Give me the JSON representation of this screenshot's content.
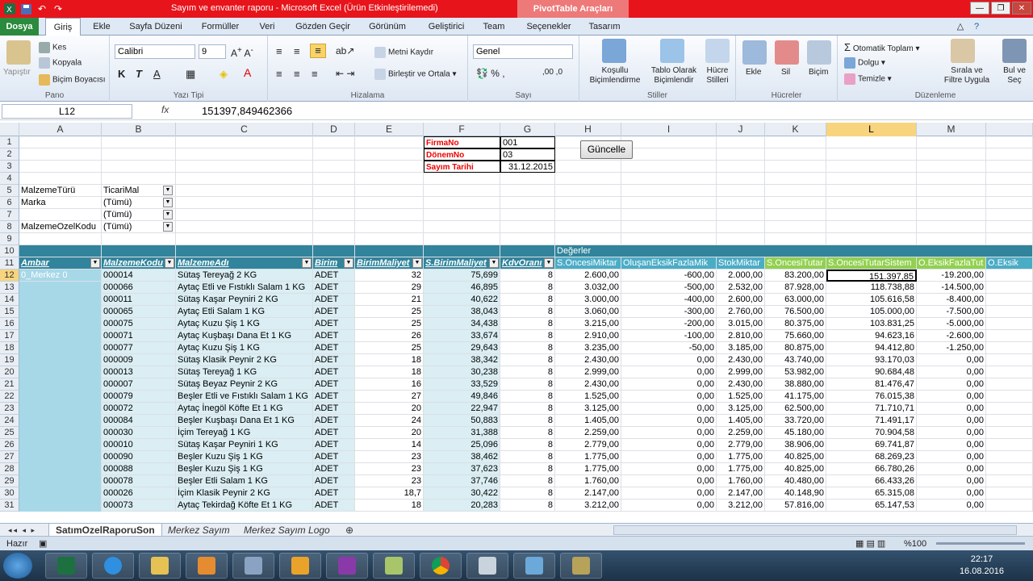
{
  "window": {
    "title": "Sayım ve envanter raporu  -  Microsoft Excel (Ürün Etkinleştirilemedi)",
    "contextual_tab": "PivotTable Araçları"
  },
  "tabs": [
    "Dosya",
    "Giriş",
    "Ekle",
    "Sayfa Düzeni",
    "Formüller",
    "Veri",
    "Gözden Geçir",
    "Görünüm",
    "Geliştirici",
    "Team",
    "Seçenekler",
    "Tasarım"
  ],
  "ribbon": {
    "pano": {
      "label": "Pano",
      "paste": "Yapıştır",
      "cut": "Kes",
      "copy": "Kopyala",
      "format_painter": "Biçim Boyacısı"
    },
    "font": {
      "label": "Yazı Tipi",
      "family": "Calibri",
      "size": "9"
    },
    "align": {
      "label": "Hizalama",
      "wrap": "Metni Kaydır",
      "merge": "Birleştir ve Ortala"
    },
    "number": {
      "label": "Sayı",
      "format": "Genel"
    },
    "styles": {
      "label": "Stiller",
      "conditional": "Koşullu Biçimlendirme",
      "table": "Tablo Olarak Biçimlendir",
      "cell": "Hücre Stilleri"
    },
    "cells": {
      "label": "Hücreler",
      "insert": "Ekle",
      "delete": "Sil",
      "format": "Biçim"
    },
    "editing": {
      "label": "Düzenleme",
      "autosum": "Otomatik Toplam",
      "fill": "Dolgu",
      "clear": "Temizle",
      "sort": "Sırala ve Filtre Uygula",
      "find": "Bul ve Seç"
    }
  },
  "formula_bar": {
    "name_box": "L12",
    "fx": "fx",
    "value": "151397,849462366"
  },
  "columns": [
    "A",
    "B",
    "C",
    "D",
    "E",
    "F",
    "G",
    "H",
    "I",
    "J",
    "K",
    "L",
    "M"
  ],
  "selected_column": "L",
  "selected_row": "12",
  "params": [
    {
      "label": "FirmaNo",
      "value": "001"
    },
    {
      "label": "DönemNo",
      "value": "03"
    },
    {
      "label": "Sayım Tarihi",
      "value": "31.12.2015"
    }
  ],
  "refresh_button": "Güncelle",
  "filters": [
    {
      "row": "5",
      "label": "MalzemeTürü",
      "value": "TicariMal"
    },
    {
      "row": "6",
      "label": "Marka",
      "value": "(Tümü)"
    },
    {
      "row": "7",
      "label": "",
      "value": "(Tümü)"
    },
    {
      "row": "8",
      "label": "MalzemeOzelKodu",
      "value": "(Tümü)"
    }
  ],
  "values_header": "Değerler",
  "pivot_headers": [
    "Ambar",
    "MalzemeKodu",
    "MalzemeAdı",
    "Birim",
    "BirimMaliyet",
    "S.BirimMaliyet",
    "KdvOranı",
    "S.OncesiMiktar",
    "OluşanEksikFazlaMik",
    "StokMiktar",
    "S.OncesiTutar",
    "S.OncesiTutarSistem",
    "O.EksikFazlaTut",
    "O.Eksik"
  ],
  "ambar_value": "0_Merkez 0",
  "rows": [
    {
      "r": "12",
      "code": "000014",
      "name": "Sütaş Tereyağ 2 KG",
      "unit": "ADET",
      "bm": "32",
      "sbm": "75,699",
      "kdv": "8",
      "som": "2.600,00",
      "oef": "-600,00",
      "stok": "2.000,00",
      "sot": "83.200,00",
      "sots": "151.397,85",
      "oeft": "-19.200,00"
    },
    {
      "r": "13",
      "code": "000066",
      "name": "Aytaç Etli ve Fıstıklı Salam 1 KG",
      "unit": "ADET",
      "bm": "29",
      "sbm": "46,895",
      "kdv": "8",
      "som": "3.032,00",
      "oef": "-500,00",
      "stok": "2.532,00",
      "sot": "87.928,00",
      "sots": "118.738,88",
      "oeft": "-14.500,00"
    },
    {
      "r": "14",
      "code": "000011",
      "name": "Sütaş Kaşar Peyniri 2 KG",
      "unit": "ADET",
      "bm": "21",
      "sbm": "40,622",
      "kdv": "8",
      "som": "3.000,00",
      "oef": "-400,00",
      "stok": "2.600,00",
      "sot": "63.000,00",
      "sots": "105.616,58",
      "oeft": "-8.400,00"
    },
    {
      "r": "15",
      "code": "000065",
      "name": "Aytaç Etli Salam 1 KG",
      "unit": "ADET",
      "bm": "25",
      "sbm": "38,043",
      "kdv": "8",
      "som": "3.060,00",
      "oef": "-300,00",
      "stok": "2.760,00",
      "sot": "76.500,00",
      "sots": "105.000,00",
      "oeft": "-7.500,00"
    },
    {
      "r": "16",
      "code": "000075",
      "name": "Aytaç Kuzu Şiş 1 KG",
      "unit": "ADET",
      "bm": "25",
      "sbm": "34,438",
      "kdv": "8",
      "som": "3.215,00",
      "oef": "-200,00",
      "stok": "3.015,00",
      "sot": "80.375,00",
      "sots": "103.831,25",
      "oeft": "-5.000,00"
    },
    {
      "r": "17",
      "code": "000071",
      "name": "Aytaç Kuşbaşı Dana Et 1 KG",
      "unit": "ADET",
      "bm": "26",
      "sbm": "33,674",
      "kdv": "8",
      "som": "2.910,00",
      "oef": "-100,00",
      "stok": "2.810,00",
      "sot": "75.660,00",
      "sots": "94.623,16",
      "oeft": "-2.600,00"
    },
    {
      "r": "18",
      "code": "000077",
      "name": "Aytaç Kuzu Şiş 1 KG",
      "unit": "ADET",
      "bm": "25",
      "sbm": "29,643",
      "kdv": "8",
      "som": "3.235,00",
      "oef": "-50,00",
      "stok": "3.185,00",
      "sot": "80.875,00",
      "sots": "94.412,80",
      "oeft": "-1.250,00"
    },
    {
      "r": "19",
      "code": "000009",
      "name": "Sütaş Klasik Peynir 2 KG",
      "unit": "ADET",
      "bm": "18",
      "sbm": "38,342",
      "kdv": "8",
      "som": "2.430,00",
      "oef": "0,00",
      "stok": "2.430,00",
      "sot": "43.740,00",
      "sots": "93.170,03",
      "oeft": "0,00"
    },
    {
      "r": "20",
      "code": "000013",
      "name": "Sütaş Tereyağ 1 KG",
      "unit": "ADET",
      "bm": "18",
      "sbm": "30,238",
      "kdv": "8",
      "som": "2.999,00",
      "oef": "0,00",
      "stok": "2.999,00",
      "sot": "53.982,00",
      "sots": "90.684,48",
      "oeft": "0,00"
    },
    {
      "r": "21",
      "code": "000007",
      "name": "Sütaş Beyaz Peynir 2 KG",
      "unit": "ADET",
      "bm": "16",
      "sbm": "33,529",
      "kdv": "8",
      "som": "2.430,00",
      "oef": "0,00",
      "stok": "2.430,00",
      "sot": "38.880,00",
      "sots": "81.476,47",
      "oeft": "0,00"
    },
    {
      "r": "22",
      "code": "000079",
      "name": "Beşler Etli ve Fıstıklı Salam 1 KG",
      "unit": "ADET",
      "bm": "27",
      "sbm": "49,846",
      "kdv": "8",
      "som": "1.525,00",
      "oef": "0,00",
      "stok": "1.525,00",
      "sot": "41.175,00",
      "sots": "76.015,38",
      "oeft": "0,00"
    },
    {
      "r": "23",
      "code": "000072",
      "name": "Aytaç İnegöl Köfte Et 1 KG",
      "unit": "ADET",
      "bm": "20",
      "sbm": "22,947",
      "kdv": "8",
      "som": "3.125,00",
      "oef": "0,00",
      "stok": "3.125,00",
      "sot": "62.500,00",
      "sots": "71.710,71",
      "oeft": "0,00"
    },
    {
      "r": "24",
      "code": "000084",
      "name": "Beşler Kuşbaşı Dana Et 1 KG",
      "unit": "ADET",
      "bm": "24",
      "sbm": "50,883",
      "kdv": "8",
      "som": "1.405,00",
      "oef": "0,00",
      "stok": "1.405,00",
      "sot": "33.720,00",
      "sots": "71.491,17",
      "oeft": "0,00"
    },
    {
      "r": "25",
      "code": "000030",
      "name": "İçim Tereyağ 1 KG",
      "unit": "ADET",
      "bm": "20",
      "sbm": "31,388",
      "kdv": "8",
      "som": "2.259,00",
      "oef": "0,00",
      "stok": "2.259,00",
      "sot": "45.180,00",
      "sots": "70.904,58",
      "oeft": "0,00"
    },
    {
      "r": "26",
      "code": "000010",
      "name": "Sütaş Kaşar Peyniri 1 KG",
      "unit": "ADET",
      "bm": "14",
      "sbm": "25,096",
      "kdv": "8",
      "som": "2.779,00",
      "oef": "0,00",
      "stok": "2.779,00",
      "sot": "38.906,00",
      "sots": "69.741,87",
      "oeft": "0,00"
    },
    {
      "r": "27",
      "code": "000090",
      "name": "Beşler Kuzu Şiş 1 KG",
      "unit": "ADET",
      "bm": "23",
      "sbm": "38,462",
      "kdv": "8",
      "som": "1.775,00",
      "oef": "0,00",
      "stok": "1.775,00",
      "sot": "40.825,00",
      "sots": "68.269,23",
      "oeft": "0,00"
    },
    {
      "r": "28",
      "code": "000088",
      "name": "Beşler Kuzu Şiş 1 KG",
      "unit": "ADET",
      "bm": "23",
      "sbm": "37,623",
      "kdv": "8",
      "som": "1.775,00",
      "oef": "0,00",
      "stok": "1.775,00",
      "sot": "40.825,00",
      "sots": "66.780,26",
      "oeft": "0,00"
    },
    {
      "r": "29",
      "code": "000078",
      "name": "Beşler Etli Salam 1 KG",
      "unit": "ADET",
      "bm": "23",
      "sbm": "37,746",
      "kdv": "8",
      "som": "1.760,00",
      "oef": "0,00",
      "stok": "1.760,00",
      "sot": "40.480,00",
      "sots": "66.433,26",
      "oeft": "0,00"
    },
    {
      "r": "30",
      "code": "000026",
      "name": "İçim Klasik Peynir 2 KG",
      "unit": "ADET",
      "bm": "18,7",
      "sbm": "30,422",
      "kdv": "8",
      "som": "2.147,00",
      "oef": "0,00",
      "stok": "2.147,00",
      "sot": "40.148,90",
      "sots": "65.315,08",
      "oeft": "0,00"
    },
    {
      "r": "31",
      "code": "000073",
      "name": "Aytaç Tekirdağ Köfte Et 1 KG",
      "unit": "ADET",
      "bm": "18",
      "sbm": "20,283",
      "kdv": "8",
      "som": "3.212,00",
      "oef": "0,00",
      "stok": "3.212,00",
      "sot": "57.816,00",
      "sots": "65.147,53",
      "oeft": "0,00"
    }
  ],
  "sheets": [
    "SatımOzelRaporuSon",
    "Merkez Sayım",
    "Merkez Sayım Logo"
  ],
  "active_sheet": "SatımOzelRaporuSon",
  "status": {
    "ready": "Hazır",
    "zoom": "%100"
  },
  "taskbar": {
    "time": "22:17",
    "date": "16.08.2016"
  },
  "colors": {
    "title_red": "#e8141b",
    "pivot_header": "#31849b",
    "values_blue": "#4bacc6",
    "values_green": "#92d050",
    "row_light": "#daeef3",
    "file_tab": "#2a8a3d"
  }
}
